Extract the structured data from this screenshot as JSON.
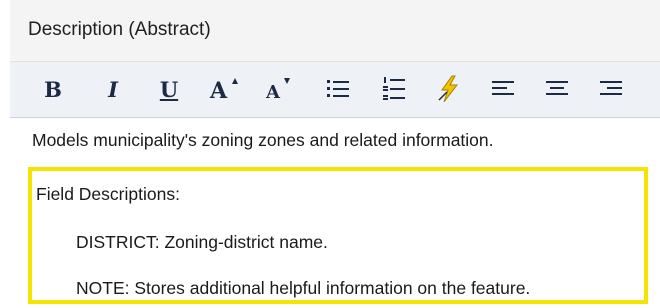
{
  "section": {
    "title": "Description (Abstract)"
  },
  "toolbar": {
    "bold_label": "B",
    "italic_label": "I",
    "underline_label": "U",
    "grow_font_label": "A",
    "shrink_font_label": "A",
    "icons": [
      "bold-icon",
      "italic-icon",
      "underline-icon",
      "grow-font-icon",
      "shrink-font-icon",
      "bulleted-list-icon",
      "numbered-list-icon",
      "clear-formatting-icon",
      "align-left-icon",
      "align-center-icon",
      "align-right-icon"
    ]
  },
  "editor": {
    "lines": [
      "Models municipality's zoning zones and related information.",
      "Field Descriptions:",
      "DISTRICT: Zoning-district name.",
      "NOTE: Stores additional helpful information on the feature."
    ]
  },
  "colors": {
    "highlight": "#f7e200",
    "toolbar_bg": "#eef1f6",
    "icon": "#1c2b45"
  }
}
